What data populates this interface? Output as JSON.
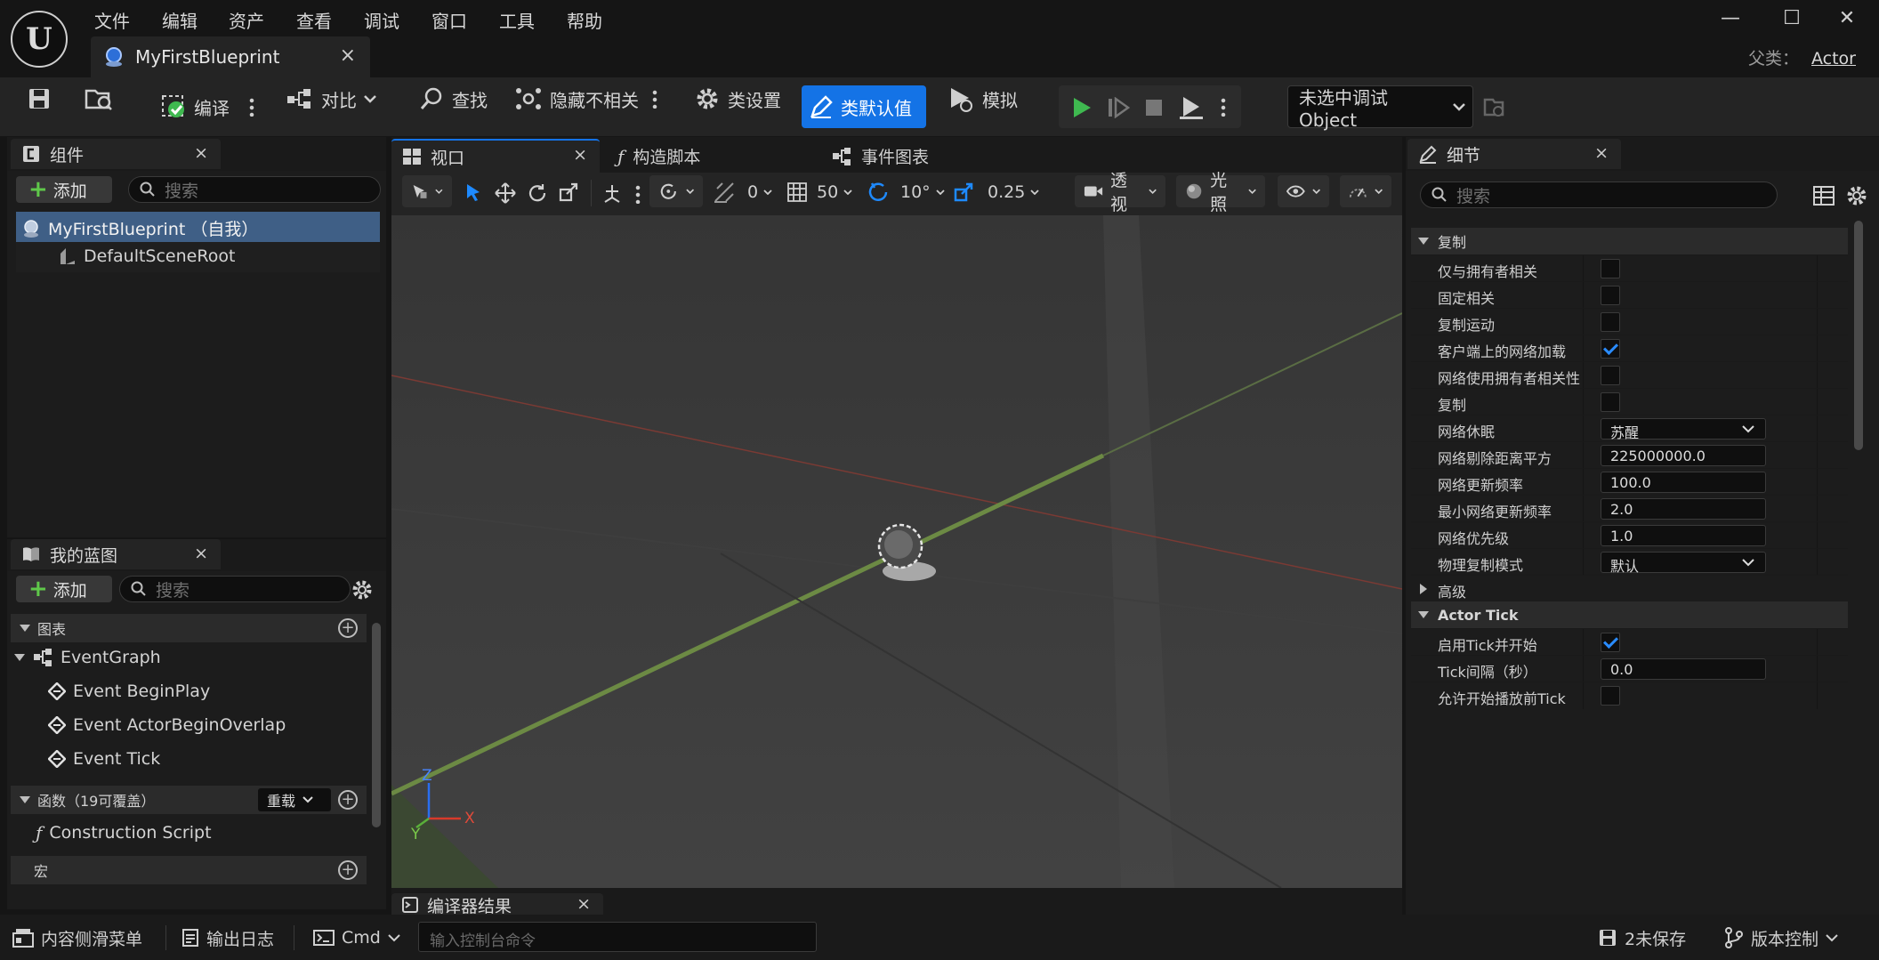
{
  "app": {
    "logo_letter": "U"
  },
  "menu": [
    "文件",
    "编辑",
    "资产",
    "查看",
    "调试",
    "窗口",
    "工具",
    "帮助"
  ],
  "document_tab": {
    "title": "MyFirstBlueprint",
    "close": "×"
  },
  "parent_class": {
    "label": "父类：",
    "value": "Actor"
  },
  "window_controls": {
    "minimize": "—",
    "maximize": "☐",
    "close": "✕"
  },
  "toolbar": {
    "compile": "编译",
    "diff": "对比",
    "find": "查找",
    "hide_unrelated": "隐藏不相关",
    "class_settings": "类设置",
    "class_defaults": "类默认值",
    "simulate": "模拟",
    "debug_object": "未选中调试Object"
  },
  "components_panel": {
    "tab": "组件",
    "add": "添加",
    "search_placeholder": "搜索",
    "items": [
      {
        "label": "MyFirstBlueprint （自我）",
        "selected": true
      },
      {
        "label": "DefaultSceneRoot",
        "selected": false
      }
    ]
  },
  "my_blueprint_panel": {
    "tab": "我的蓝图",
    "add": "添加",
    "search_placeholder": "搜索",
    "graphs_header": "图表",
    "event_graph": "EventGraph",
    "events": [
      "Event BeginPlay",
      "Event ActorBeginOverlap",
      "Event Tick"
    ],
    "functions_header": "函数（19可覆盖）",
    "override_label": "重载",
    "construction_script": "Construction Script",
    "macros_header": "宏"
  },
  "editor_tabs": {
    "viewport": "视口",
    "construction": "构造脚本",
    "event_graph": "事件图表"
  },
  "viewport_toolbar": {
    "rotation_snap_label": "0",
    "grid_snap": "50",
    "angle_snap": "10°",
    "scale_snap": "0.25",
    "perspective": "透视",
    "lighting": "光照"
  },
  "axis_labels": {
    "z": "Z",
    "x": "X",
    "y": "Y"
  },
  "compiler_results": {
    "tab": "编译器结果"
  },
  "details_panel": {
    "tab": "细节",
    "search_placeholder": "搜索",
    "replication_header": "复制",
    "rows": [
      {
        "label": "仅与拥有者相关",
        "type": "check",
        "checked": false
      },
      {
        "label": "固定相关",
        "type": "check",
        "checked": false
      },
      {
        "label": "复制运动",
        "type": "check",
        "checked": false
      },
      {
        "label": "客户端上的网络加载",
        "type": "check",
        "checked": true
      },
      {
        "label": "网络使用拥有者相关性",
        "type": "check",
        "checked": false
      },
      {
        "label": "复制",
        "type": "check",
        "checked": false
      },
      {
        "label": "网络休眠",
        "type": "dropdown",
        "value": "苏醒"
      },
      {
        "label": "网络剔除距离平方",
        "type": "number",
        "value": "225000000.0"
      },
      {
        "label": "网络更新频率",
        "type": "number",
        "value": "100.0"
      },
      {
        "label": "最小网络更新频率",
        "type": "number",
        "value": "2.0"
      },
      {
        "label": "网络优先级",
        "type": "number",
        "value": "1.0"
      },
      {
        "label": "物理复制模式",
        "type": "dropdown",
        "value": "默认"
      }
    ],
    "advanced_label": "高级",
    "actor_tick_header": "Actor Tick",
    "tick_rows": [
      {
        "label": "启用Tick并开始",
        "type": "check",
        "checked": true
      },
      {
        "label": "Tick间隔（秒）",
        "type": "number",
        "value": "0.0"
      },
      {
        "label": "允许开始播放前Tick",
        "type": "check",
        "checked": false
      }
    ]
  },
  "bottom_bar": {
    "content_drawer": "内容侧滑菜单",
    "output_log": "输出日志",
    "cmd": "Cmd",
    "console_placeholder": "输入控制台命令",
    "unsaved": "2未保存",
    "source_control": "版本控制"
  },
  "colors": {
    "accent_blue": "#1473e6",
    "play_green": "#3fb950",
    "selection": "#3f5f86"
  }
}
